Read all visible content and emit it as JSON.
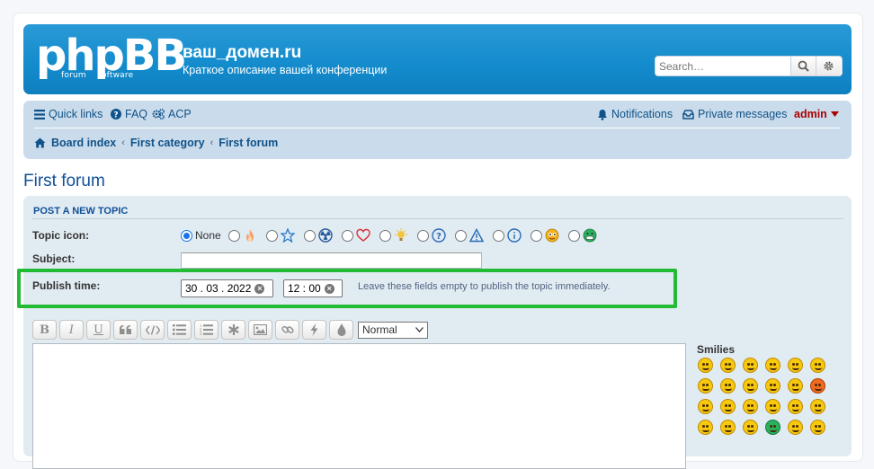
{
  "header": {
    "logo_text": "phpBB",
    "logo_subtext": "forum    software",
    "site_title": "ваш_домен.ru",
    "site_description": "Краткое описание вашей конференции",
    "search_placeholder": "Search…"
  },
  "nav": {
    "quick_links": "Quick links",
    "faq": "FAQ",
    "acp": "ACP",
    "notifications": "Notifications",
    "private_messages": "Private messages",
    "username": "admin",
    "breadcrumbs": [
      "Board index",
      "First category",
      "First forum"
    ]
  },
  "page": {
    "title": "First forum"
  },
  "form": {
    "heading": "POST A NEW TOPIC",
    "topic_icon_label": "Topic icon:",
    "topic_icon_none": "None",
    "topic_icons": [
      "fire-icon",
      "star-icon",
      "radioactive-icon",
      "heart-icon",
      "lightbulb-icon",
      "question-icon",
      "warning-icon",
      "info-icon",
      "smiley-wink-icon",
      "smiley-grin-icon"
    ],
    "subject_label": "Subject:",
    "subject_value": "",
    "publish_time_label": "Publish time:",
    "publish_date": "30 . 03 . 2022",
    "publish_time": "12 : 00",
    "publish_hint": "Leave these fields empty to publish the topic immediately.",
    "highlight_color": "#22bb33"
  },
  "toolbar": {
    "buttons": [
      "B",
      "I",
      "U",
      "quote",
      "code",
      "list",
      "numbered-list",
      "list-item",
      "image",
      "link",
      "flash",
      "color"
    ],
    "font_size_value": "Normal"
  },
  "smilies": {
    "label": "Smilies",
    "count": 24
  },
  "colors": {
    "header_blue": "#1b8dcc",
    "nav_bg": "#cadceb",
    "panel_bg": "#e1ebf2",
    "link": "#105289",
    "username": "#aa0000"
  }
}
